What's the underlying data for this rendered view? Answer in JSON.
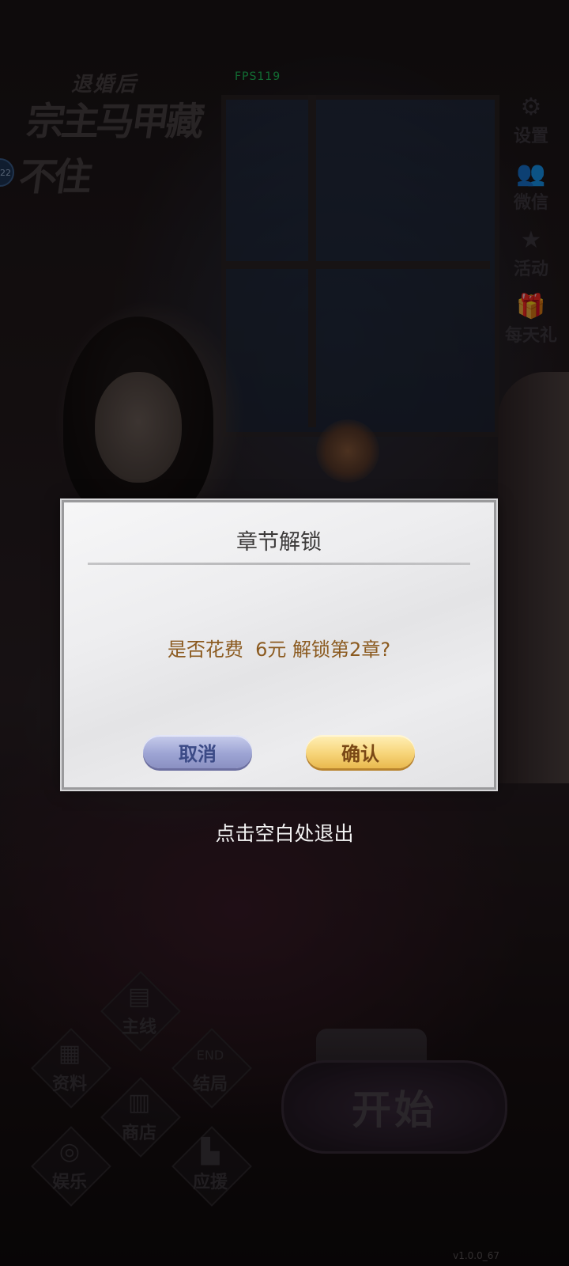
{
  "hud": {
    "fps": "FPS119",
    "version": "v1.0.0_67",
    "side_badge": "22"
  },
  "logo": {
    "line1": "退婚后",
    "line2": "宗主马甲藏不住"
  },
  "right_menu": [
    {
      "label": "设置",
      "icon": "gear-icon",
      "glyph": "⚙"
    },
    {
      "label": "微信",
      "icon": "people-icon",
      "glyph": "👥"
    },
    {
      "label": "活动",
      "icon": "star-icon",
      "glyph": "★"
    },
    {
      "label": "每天礼",
      "icon": "gift-icon",
      "glyph": "🎁"
    }
  ],
  "bottom_menu": {
    "main_line": "主线",
    "profile": "资料",
    "ending": "结局",
    "shop": "商店",
    "entertainment": "娱乐",
    "ranking": "应援",
    "start": "开始"
  },
  "dialog": {
    "title": "章节解锁",
    "message": "是否花费  6元 解锁第2章?",
    "cancel_label": "取消",
    "confirm_label": "确认"
  },
  "exit_hint": "点击空白处退出",
  "colors": {
    "confirm": "#f7d57a",
    "cancel": "#9ea5d4",
    "message": "#8b5a1f",
    "fps": "#22c55e"
  }
}
